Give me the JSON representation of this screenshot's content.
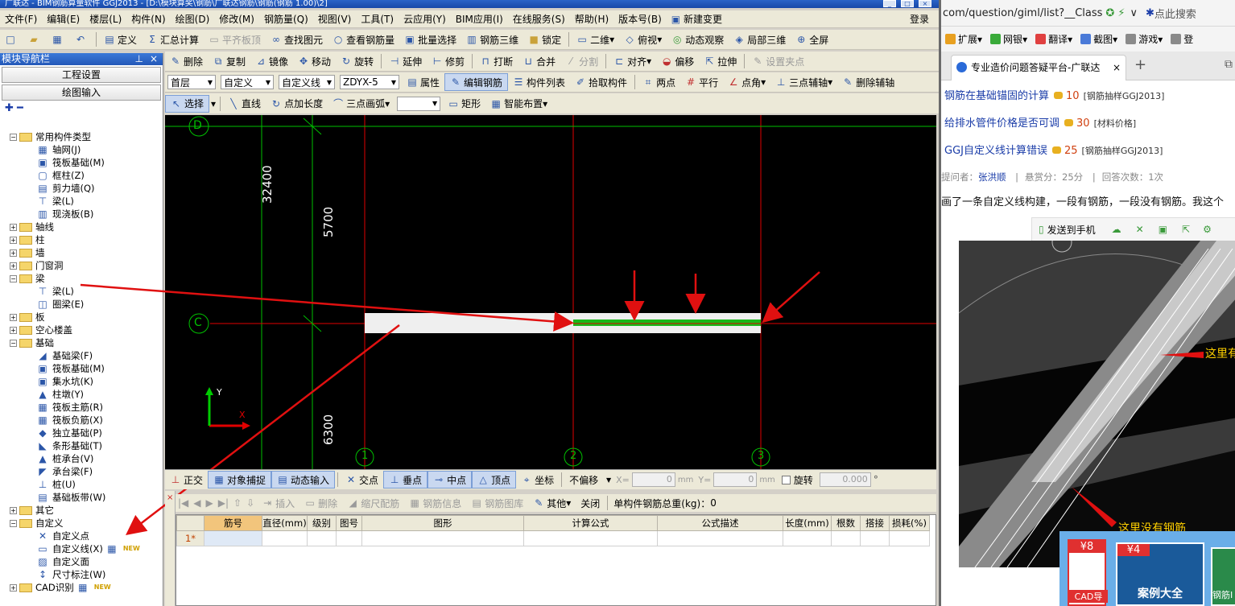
{
  "window": {
    "title": "广联达 - BIM钢筋算量软件 GGJ2013 - [D:\\模块算奖\\钢筋\\广联达钢筋\\钢筋(钢筋 1.00)\\2]"
  },
  "menu": [
    "文件(F)",
    "编辑(E)",
    "楼层(L)",
    "构件(N)",
    "绘图(D)",
    "修改(M)",
    "钢筋量(Q)",
    "视图(V)",
    "工具(T)",
    "云应用(Y)",
    "BIM应用(I)",
    "在线服务(S)",
    "帮助(H)",
    "版本号(B)",
    "新建变更",
    "登录"
  ],
  "toolbar1": {
    "define": "定义",
    "sum": "汇总计算",
    "flat": "平齐板顶",
    "find": "查找图元",
    "view_rebar": "查看钢筋量",
    "batch": "批量选择",
    "rebar3d": "钢筋三维",
    "lock": "锁定",
    "view2d": "二维",
    "top": "俯视",
    "dynamic": "动态观察",
    "local3d": "局部三维",
    "fullscreen": "全屏"
  },
  "toolbar2": [
    "删除",
    "复制",
    "镜像",
    "移动",
    "旋转",
    "延伸",
    "修剪",
    "打断",
    "合并",
    "分割",
    "对齐",
    "偏移",
    "拉伸",
    "设置夹点"
  ],
  "toolbar3": {
    "floor": "首层",
    "type": "自定义",
    "subtype": "自定义线",
    "element": "ZDYX-5",
    "items": [
      "属性",
      "编辑钢筋",
      "构件列表",
      "拾取构件",
      "两点",
      "平行",
      "点角",
      "三点辅轴",
      "删除辅轴"
    ]
  },
  "toolbar4": [
    "选择",
    "直线",
    "点加长度",
    "三点画弧",
    "矩形",
    "智能布置"
  ],
  "nav": {
    "title": "模块导航栏",
    "project_settings": "工程设置",
    "draw_input": "绘图输入",
    "tree": [
      {
        "label": "常用构件类型",
        "level": 0,
        "folder": true,
        "expanded": true
      },
      {
        "label": "轴网(J)",
        "level": 1,
        "icon": "grid-icon"
      },
      {
        "label": "筏板基础(M)",
        "level": 1,
        "icon": "raft-icon"
      },
      {
        "label": "框柱(Z)",
        "level": 1,
        "icon": "column-icon"
      },
      {
        "label": "剪力墙(Q)",
        "level": 1,
        "icon": "wall-icon"
      },
      {
        "label": "梁(L)",
        "level": 1,
        "icon": "beam-icon"
      },
      {
        "label": "现浇板(B)",
        "level": 1,
        "icon": "slab-icon"
      },
      {
        "label": "轴线",
        "level": 0,
        "folder": true,
        "expanded": false
      },
      {
        "label": "柱",
        "level": 0,
        "folder": true,
        "expanded": false
      },
      {
        "label": "墙",
        "level": 0,
        "folder": true,
        "expanded": false
      },
      {
        "label": "门窗洞",
        "level": 0,
        "folder": true,
        "expanded": false
      },
      {
        "label": "梁",
        "level": 0,
        "folder": true,
        "expanded": true
      },
      {
        "label": "梁(L)",
        "level": 1,
        "icon": "beam-icon"
      },
      {
        "label": "圈梁(E)",
        "level": 1,
        "icon": "ring-beam-icon"
      },
      {
        "label": "板",
        "level": 0,
        "folder": true,
        "expanded": false
      },
      {
        "label": "空心楼盖",
        "level": 0,
        "folder": true,
        "expanded": false
      },
      {
        "label": "基础",
        "level": 0,
        "folder": true,
        "expanded": true
      },
      {
        "label": "基础梁(F)",
        "level": 1,
        "icon": "foundation-beam-icon"
      },
      {
        "label": "筏板基础(M)",
        "level": 1,
        "icon": "raft-icon"
      },
      {
        "label": "集水坑(K)",
        "level": 1,
        "icon": "sump-icon"
      },
      {
        "label": "柱墩(Y)",
        "level": 1,
        "icon": "pier-icon"
      },
      {
        "label": "筏板主筋(R)",
        "level": 1,
        "icon": "rebar-icon"
      },
      {
        "label": "筏板负筋(X)",
        "level": 1,
        "icon": "rebar-icon"
      },
      {
        "label": "独立基础(P)",
        "level": 1,
        "icon": "footing-icon"
      },
      {
        "label": "条形基础(T)",
        "level": 1,
        "icon": "strip-footing-icon"
      },
      {
        "label": "桩承台(V)",
        "level": 1,
        "icon": "pile-cap-icon"
      },
      {
        "label": "承台梁(F)",
        "level": 1,
        "icon": "cap-beam-icon"
      },
      {
        "label": "桩(U)",
        "level": 1,
        "icon": "pile-icon"
      },
      {
        "label": "基础板带(W)",
        "level": 1,
        "icon": "strip-icon"
      },
      {
        "label": "其它",
        "level": 0,
        "folder": true,
        "expanded": false
      },
      {
        "label": "自定义",
        "level": 0,
        "folder": true,
        "expanded": true
      },
      {
        "label": "自定义点",
        "level": 1,
        "icon": "custom-point-icon"
      },
      {
        "label": "自定义线(X)",
        "level": 1,
        "icon": "custom-line-icon",
        "new": true
      },
      {
        "label": "自定义面",
        "level": 1,
        "icon": "custom-face-icon"
      },
      {
        "label": "尺寸标注(W)",
        "level": 1,
        "icon": "dimension-icon"
      },
      {
        "label": "CAD识别",
        "level": 0,
        "folder": true,
        "expanded": false,
        "new": true
      }
    ],
    "new_badge": "NEW"
  },
  "canvas": {
    "axis_labels": {
      "d": "D",
      "c": "C",
      "n1": "1",
      "n2": "2",
      "n3": "3"
    },
    "dims": {
      "d1": "32400",
      "d2": "5700",
      "d3": "6300"
    },
    "ucs": {
      "y": "Y",
      "x": "X"
    }
  },
  "snapbar": {
    "ortho": "正交",
    "snap": "对象捕捉",
    "dyninput": "动态输入",
    "cross": "交点",
    "perp": "垂点",
    "mid": "中点",
    "vertex": "顶点",
    "coord": "坐标",
    "offset": "不偏移",
    "x_label": "X=",
    "x_val": "0",
    "y_label": "Y=",
    "y_val": "0",
    "unit": "mm",
    "rotate": "旋转",
    "rot_val": "0.000",
    "deg": "°"
  },
  "rebarbar": {
    "insert": "插入",
    "delete": "删除",
    "scale": "缩尺配筋",
    "info": "钢筋信息",
    "lib": "钢筋图库",
    "other": "其他",
    "close": "关闭",
    "total_label": "单构件钢筋总重(kg)：",
    "total": "0"
  },
  "grid": {
    "headers": [
      "",
      "筋号",
      "直径(mm)",
      "级别",
      "图号",
      "图形",
      "计算公式",
      "公式描述",
      "长度(mm)",
      "根数",
      "搭接",
      "损耗(%)"
    ],
    "row1": "1*"
  },
  "browser": {
    "url": "com/question/giml/list?__Class",
    "search": "点此搜索",
    "bookmarks": [
      "扩展",
      "网银",
      "翻译",
      "截图",
      "游戏",
      "登"
    ],
    "tab_title": "专业造价问题答疑平台-广联达",
    "questions": [
      {
        "title": "钢筋在基础锚固的计算",
        "score": "10",
        "tag": "[钢筋抽样GGJ2013]"
      },
      {
        "title": "给排水管件价格是否可调",
        "score": "30",
        "tag": "[材料价格]"
      },
      {
        "title": "GGJ自定义线计算错误",
        "score": "25",
        "tag": "[钢筋抽样GGJ2013]"
      }
    ],
    "asker_label": "提问者：",
    "asker": "张洪顺",
    "reward": "悬赏分：25分",
    "answers": "回答次数：1次",
    "question_text": "画了一条自定义线构建，一段有钢筋，一段没有钢筋。我这个",
    "send_phone": "发送到手机",
    "note1": "这里有",
    "note2": "这里没有钢筋",
    "ad": {
      "badge1": "¥8",
      "badge2": "¥4",
      "cad": "CAD导",
      "cases": "案例大全",
      "rebar": "钢筋I"
    }
  },
  "colors": {
    "annotation_red": "#e01010",
    "beam_green": "#18b818",
    "axis_green": "#00cc00",
    "canvas": "#000000"
  }
}
